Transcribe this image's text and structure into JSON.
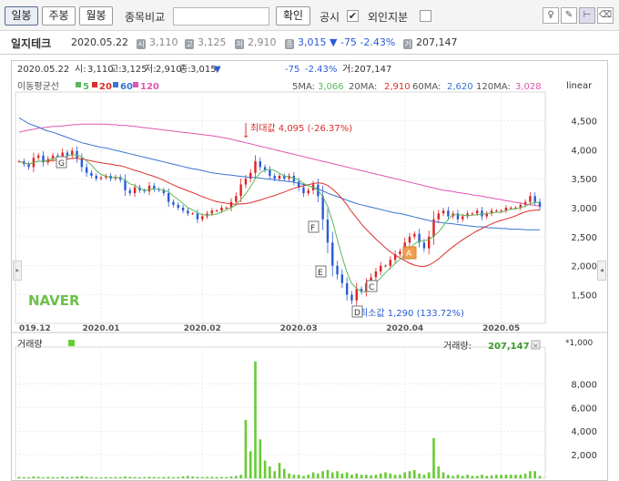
{
  "toolbar": {
    "daily": "일봉",
    "weekly": "주봉",
    "monthly": "월봉",
    "compare_label": "종목비교",
    "compare_value": "",
    "confirm": "확인",
    "disclosure": "공시",
    "foreign": "외인지분"
  },
  "stock": {
    "name": "일지테크",
    "date": "2020.05.22",
    "open": "3,110",
    "high": "3,125",
    "low": "2,910",
    "close": "3,015",
    "change_arrow": "▼",
    "change": "-75",
    "change_pct": "-2.43%",
    "volume": "207,147",
    "icons": {
      "open": "시",
      "high": "고",
      "low": "저",
      "close": "종",
      "volume": "거"
    }
  },
  "colors": {
    "up": "#e02020",
    "down": "#2a5bd7",
    "ma5": "#5cb85c",
    "ma20": "#d9302b",
    "ma60": "#3a74cf",
    "ma120": "#e055b0",
    "volume": "#66cc33"
  },
  "chart_data": [
    {
      "type": "candlestick",
      "header": {
        "date": "2020.05.22",
        "open_label": "시:",
        "open": "3,110",
        "high_label": "고:",
        "high": "3,125",
        "low_label": "저:",
        "low": "2,910",
        "close_label": "종:",
        "close": "3,015",
        "arrow": "▼",
        "change": "-75",
        "change_pct": "-2.43%",
        "volume_label": "거:",
        "volume": "207,147"
      },
      "ma_legend": {
        "title": "이동평균선",
        "items": [
          {
            "label": "5"
          },
          {
            "label": "20"
          },
          {
            "label": "60"
          },
          {
            "label": "120"
          }
        ]
      },
      "ma_values": {
        "label5": "5MA:",
        "v5": "3,066",
        "label20": "20MA:",
        "v20": "2,910",
        "label60": "60MA:",
        "v60": "2,620",
        "label120": "120MA:",
        "v120": "3,028"
      },
      "scale": "linear",
      "ylim": [
        1100,
        4900
      ],
      "yticks": [
        {
          "v": 1500,
          "l": "1,500"
        },
        {
          "v": 2000,
          "l": "2,000"
        },
        {
          "v": 2500,
          "l": "2,500"
        },
        {
          "v": 3000,
          "l": "3,000"
        },
        {
          "v": 3500,
          "l": "3,500"
        },
        {
          "v": 4000,
          "l": "4,000"
        },
        {
          "v": 4500,
          "l": "4,500"
        }
      ],
      "xticks": [
        {
          "i": 0,
          "l": "019.12"
        },
        {
          "i": 17,
          "l": "2020.01"
        },
        {
          "i": 38,
          "l": "2020.02"
        },
        {
          "i": 58,
          "l": "2020.03"
        },
        {
          "i": 80,
          "l": "2020.04"
        },
        {
          "i": 100,
          "l": "2020.05"
        }
      ],
      "max_note": "최대값 4,095 (-26.37%)",
      "min_note": "최소값 1,290 (133.72%)",
      "markers": [
        "G",
        "F",
        "E",
        "C",
        "D",
        "A"
      ],
      "watermark": "NAVER",
      "closes": [
        3800,
        3750,
        3700,
        3860,
        3900,
        3780,
        3840,
        3900,
        3850,
        3950,
        3900,
        3980,
        3850,
        3700,
        3600,
        3550,
        3500,
        3520,
        3550,
        3500,
        3530,
        3480,
        3300,
        3250,
        3350,
        3300,
        3280,
        3380,
        3320,
        3300,
        3250,
        3100,
        3050,
        3000,
        2950,
        2900,
        2900,
        2800,
        2850,
        2900,
        2950,
        2950,
        3000,
        3000,
        3100,
        3200,
        3400,
        3500,
        3600,
        3800,
        3700,
        3650,
        3550,
        3500,
        3550,
        3500,
        3550,
        3450,
        3350,
        3250,
        3300,
        3400,
        3200,
        2800,
        2400,
        2000,
        1850,
        1700,
        1500,
        1400,
        1600,
        1550,
        1700,
        1800,
        1900,
        2000,
        2000,
        2100,
        2200,
        2250,
        2400,
        2500,
        2550,
        2400,
        2300,
        2500,
        2800,
        2900,
        2950,
        2850,
        2900,
        2800,
        2850,
        2900,
        2900,
        2950,
        2850,
        2900,
        2950,
        2950,
        2950,
        3000,
        3000,
        3000,
        3050,
        3100,
        3200,
        3100,
        3015
      ],
      "ma60": [
        4550,
        4500,
        4450,
        4420,
        4390,
        4350,
        4320,
        4300,
        4270,
        4240,
        4210,
        4180,
        4150,
        4120,
        4100,
        4080,
        4060,
        4040,
        4030,
        4010,
        3990,
        3970,
        3950,
        3930,
        3910,
        3890,
        3870,
        3850,
        3830,
        3810,
        3790,
        3770,
        3750,
        3730,
        3710,
        3690,
        3670,
        3660,
        3640,
        3620,
        3600,
        3590,
        3580,
        3570,
        3560,
        3550,
        3540,
        3530,
        3520,
        3520,
        3510,
        3500,
        3490,
        3480,
        3470,
        3460,
        3450,
        3440,
        3420,
        3400,
        3380,
        3350,
        3320,
        3290,
        3250,
        3220,
        3190,
        3160,
        3130,
        3100,
        3070,
        3050,
        3030,
        3010,
        2990,
        2970,
        2950,
        2930,
        2910,
        2900,
        2880,
        2860,
        2840,
        2820,
        2800,
        2780,
        2760,
        2750,
        2740,
        2730,
        2720,
        2710,
        2700,
        2690,
        2680,
        2670,
        2670,
        2660,
        2650,
        2650,
        2640,
        2640,
        2630,
        2630,
        2630,
        2620,
        2620,
        2620,
        2620
      ],
      "ma120": [
        4300,
        4320,
        4340,
        4350,
        4370,
        4380,
        4390,
        4400,
        4400,
        4410,
        4420,
        4430,
        4430,
        4440,
        4440,
        4440,
        4440,
        4440,
        4440,
        4430,
        4430,
        4420,
        4420,
        4410,
        4400,
        4390,
        4380,
        4370,
        4360,
        4350,
        4340,
        4330,
        4320,
        4310,
        4300,
        4290,
        4280,
        4270,
        4260,
        4250,
        4240,
        4230,
        4210,
        4200,
        4180,
        4160,
        4140,
        4120,
        4100,
        4080,
        4060,
        4040,
        4020,
        4000,
        3980,
        3960,
        3940,
        3920,
        3900,
        3880,
        3860,
        3840,
        3820,
        3800,
        3780,
        3760,
        3740,
        3720,
        3700,
        3680,
        3660,
        3640,
        3620,
        3600,
        3580,
        3560,
        3540,
        3520,
        3500,
        3480,
        3460,
        3440,
        3420,
        3400,
        3380,
        3360,
        3340,
        3320,
        3300,
        3290,
        3280,
        3260,
        3250,
        3240,
        3220,
        3210,
        3200,
        3180,
        3170,
        3150,
        3140,
        3120,
        3110,
        3090,
        3080,
        3060,
        3050,
        3040,
        3028
      ]
    },
    {
      "type": "bar",
      "title": "거래량",
      "value_label": "거래량:",
      "value": "207,147",
      "unit": "*1,000",
      "ylim": [
        0,
        10500
      ],
      "yticks": [
        {
          "v": 2000,
          "l": "2,000"
        },
        {
          "v": 4000,
          "l": "4,000"
        },
        {
          "v": 6000,
          "l": "6,000"
        },
        {
          "v": 8000,
          "l": "8,000"
        }
      ],
      "values": [
        120,
        100,
        90,
        150,
        130,
        80,
        110,
        100,
        90,
        140,
        100,
        120,
        150,
        180,
        120,
        100,
        90,
        80,
        100,
        90,
        110,
        100,
        150,
        120,
        100,
        90,
        100,
        130,
        100,
        90,
        110,
        120,
        100,
        100,
        150,
        200,
        150,
        120,
        100,
        110,
        120,
        100,
        110,
        100,
        150,
        200,
        300,
        4950,
        2300,
        9900,
        3300,
        1500,
        1000,
        600,
        1300,
        800,
        400,
        300,
        300,
        200,
        300,
        500,
        400,
        600,
        700,
        500,
        600,
        400,
        500,
        300,
        400,
        300,
        300,
        250,
        300,
        400,
        500,
        400,
        300,
        300,
        500,
        600,
        700,
        400,
        300,
        500,
        3400,
        1000,
        500,
        300,
        200,
        300,
        200,
        300,
        200,
        200,
        300,
        200,
        250,
        300,
        300,
        300,
        300,
        300,
        300,
        400,
        600,
        600,
        207
      ]
    }
  ]
}
